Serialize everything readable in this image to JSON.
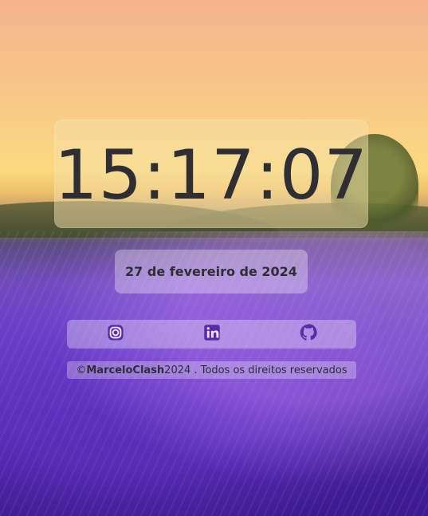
{
  "clock": {
    "time": "15:17:07"
  },
  "date": {
    "text": "27 de fevereiro de 2024"
  },
  "social": {
    "accent": "#5b2aa8",
    "icons": [
      "instagram-icon",
      "linkedin-icon",
      "github-icon"
    ]
  },
  "footer": {
    "copyright_symbol": "©",
    "brand": "MarceloClash",
    "rest": "2024 . Todos os direitos reservados"
  },
  "colors": {
    "panel_text": "#2f2f33"
  }
}
